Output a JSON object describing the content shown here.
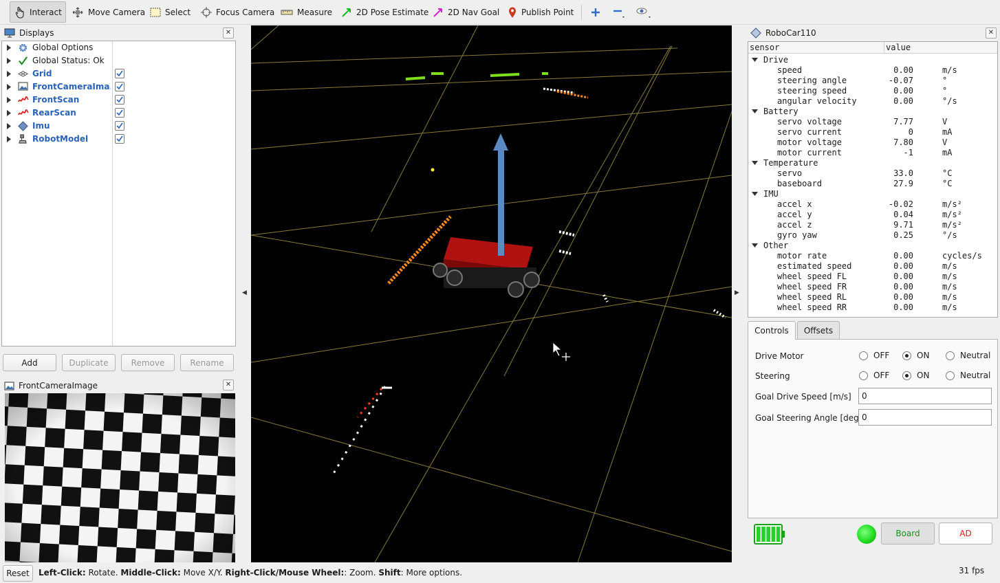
{
  "toolbar": {
    "interact": "Interact",
    "move_camera": "Move Camera",
    "select": "Select",
    "focus_camera": "Focus Camera",
    "measure": "Measure",
    "pose_estimate": "2D Pose Estimate",
    "nav_goal": "2D Nav Goal",
    "publish_point": "Publish Point"
  },
  "displays": {
    "title": "Displays",
    "items": [
      {
        "label": "Global Options",
        "icon": "gear-icon"
      },
      {
        "label": "Global Status: Ok",
        "icon": "check-icon"
      },
      {
        "label": "Grid",
        "icon": "grid-icon",
        "checked": true
      },
      {
        "label": "FrontCameraIma...",
        "icon": "image-icon",
        "checked": true
      },
      {
        "label": "FrontScan",
        "icon": "laserscan-icon",
        "checked": true
      },
      {
        "label": "RearScan",
        "icon": "laserscan-icon",
        "checked": true
      },
      {
        "label": "Imu",
        "icon": "imu-icon",
        "checked": true
      },
      {
        "label": "RobotModel",
        "icon": "robot-icon",
        "checked": true
      }
    ],
    "buttons": {
      "add": "Add",
      "duplicate": "Duplicate",
      "remove": "Remove",
      "rename": "Rename"
    }
  },
  "camera_panel": {
    "title": "FrontCameraImage"
  },
  "robot_panel": {
    "title": "RoboCar110",
    "columns": {
      "sensor": "sensor",
      "value": "value"
    },
    "groups": [
      {
        "name": "Drive",
        "rows": [
          {
            "name": "speed",
            "value": "0.00",
            "unit": "m/s"
          },
          {
            "name": "steering angle",
            "value": "-0.07",
            "unit": "°"
          },
          {
            "name": "steering speed",
            "value": "0.00",
            "unit": "°"
          },
          {
            "name": "angular velocity",
            "value": "0.00",
            "unit": "°/s"
          }
        ]
      },
      {
        "name": "Battery",
        "rows": [
          {
            "name": "servo voltage",
            "value": "7.77",
            "unit": "V"
          },
          {
            "name": "servo current",
            "value": "0",
            "unit": "mA"
          },
          {
            "name": "motor voltage",
            "value": "7.80",
            "unit": "V"
          },
          {
            "name": "motor current",
            "value": "-1",
            "unit": "mA"
          }
        ]
      },
      {
        "name": "Temperature",
        "rows": [
          {
            "name": "servo",
            "value": "33.0",
            "unit": "°C"
          },
          {
            "name": "baseboard",
            "value": "27.9",
            "unit": "°C"
          }
        ]
      },
      {
        "name": "IMU",
        "rows": [
          {
            "name": "accel x",
            "value": "-0.02",
            "unit": "m/s²"
          },
          {
            "name": "accel y",
            "value": "0.04",
            "unit": "m/s²"
          },
          {
            "name": "accel z",
            "value": "9.71",
            "unit": "m/s²"
          },
          {
            "name": "gyro yaw",
            "value": "0.25",
            "unit": "°/s"
          }
        ]
      },
      {
        "name": "Other",
        "rows": [
          {
            "name": "motor rate",
            "value": "0.00",
            "unit": "cycles/s"
          },
          {
            "name": "estimated speed",
            "value": "0.00",
            "unit": "m/s"
          },
          {
            "name": "wheel speed FL",
            "value": "0.00",
            "unit": "m/s"
          },
          {
            "name": "wheel speed FR",
            "value": "0.00",
            "unit": "m/s"
          },
          {
            "name": "wheel speed RL",
            "value": "0.00",
            "unit": "m/s"
          },
          {
            "name": "wheel speed RR",
            "value": "0.00",
            "unit": "m/s"
          }
        ]
      }
    ],
    "tabs": {
      "controls": "Controls",
      "offsets": "Offsets"
    },
    "controls": {
      "drive_motor": {
        "label": "Drive Motor",
        "options": [
          "OFF",
          "ON",
          "Neutral"
        ],
        "selected": "ON"
      },
      "steering": {
        "label": "Steering",
        "options": [
          "OFF",
          "ON",
          "Neutral"
        ],
        "selected": "ON"
      },
      "goal_speed": {
        "label": "Goal Drive Speed [m/s]",
        "value": "0"
      },
      "goal_angle": {
        "label": "Goal Steering Angle [deg]",
        "value": "0"
      }
    },
    "footer": {
      "board": "Board",
      "ad": "AD",
      "battery_level": 1.0,
      "status_color": "#22dd22"
    }
  },
  "statusbar": {
    "reset": "Reset",
    "hint_left_key": "Left-Click:",
    "hint_left": " Rotate. ",
    "hint_middle_key": "Middle-Click:",
    "hint_middle": " Move X/Y. ",
    "hint_right_key": "Right-Click/Mouse Wheel:",
    "hint_right": ": Zoom. ",
    "hint_shift_key": "Shift",
    "hint_shift": ": More options.",
    "fps": "31 fps"
  }
}
